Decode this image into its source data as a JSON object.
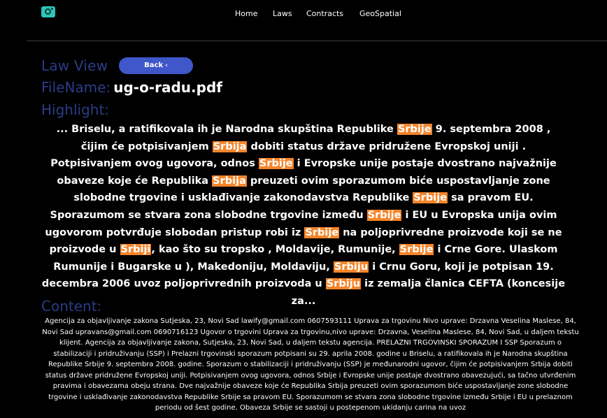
{
  "nav": {
    "logo_icon": "eye-glasses-icon",
    "links": [
      "Home",
      "Laws",
      "Contracts",
      "GeoSpatial"
    ]
  },
  "header": {
    "law_view_label": "Law View",
    "back_label": "Back",
    "back_icon": "chevron-left-icon"
  },
  "file": {
    "label": "FileName:",
    "value": "ug-o-radu.pdf"
  },
  "highlight": {
    "label": "Highlight:",
    "accent_color": "#f5852b",
    "segments": [
      {
        "t": "... Briselu, a ratifikovala ih je Narodna skupština Republike ",
        "h": false
      },
      {
        "t": "Srbije",
        "h": true
      },
      {
        "t": " 9. septembra 2008 , čijim će potpisivanjem ",
        "h": false
      },
      {
        "t": "Srbija",
        "h": true
      },
      {
        "t": " dobiti status države pridružene Evropskoj uniji . Potpisivanjem ovog ugovora, odnos ",
        "h": false
      },
      {
        "t": "Srbije",
        "h": true
      },
      {
        "t": " i Evropske unije postaje dvostrano najvažnije obaveze koje će Republika ",
        "h": false
      },
      {
        "t": "Srbija",
        "h": true
      },
      {
        "t": " preuzeti ovim sporazumom biće uspostavljanje zone slobodne trgovine i usklađivanje zakonodavstva Republike ",
        "h": false
      },
      {
        "t": "Srbije",
        "h": true
      },
      {
        "t": " sa pravom EU. Sporazumom se stvara zona slobodne trgovine između ",
        "h": false
      },
      {
        "t": "Srbije",
        "h": true
      },
      {
        "t": " i EU u Evropska unija ovim ugovorom potvrđuje slobodan pristup robi iz ",
        "h": false
      },
      {
        "t": "Srbije",
        "h": true
      },
      {
        "t": " na poljoprivredne proizvode koji se ne proizvode u ",
        "h": false
      },
      {
        "t": "Srbiji",
        "h": true
      },
      {
        "t": ", kao što su tropsko , Moldavije, Rumunije, ",
        "h": false
      },
      {
        "t": "Srbije",
        "h": true
      },
      {
        "t": " i Crne Gore. Ulaskom Rumunije i Bugarske u ), Makedoniju, Moldaviju, ",
        "h": false
      },
      {
        "t": "Srbiju",
        "h": true
      },
      {
        "t": " i Crnu Goru, koji je potpisan 19. decembra 2006 uvoz poljoprivrednih proizvoda u ",
        "h": false
      },
      {
        "t": "Srbiju",
        "h": true
      },
      {
        "t": " iz zemalja članica CEFTA (koncesije za...",
        "h": false
      }
    ]
  },
  "content": {
    "label": "Content:",
    "text": "Agencija za objavljivanje zakona Sutjeska, 23, Novi Sad lawify@gmail.com 0607593111 Uprava za trgovinu Nivo uprave: Drzavna Veselina Maslese, 84, Novi Sad upravans@gmail.com 0690716123 Ugovor o trgovini Uprava za trgovinu,nivo uprave: Drzavna, Veselina Maslese, 84, Novi Sad, u daljem tekstu klijent. Agencija za objavljivanje zakona, Sutjeska, 23, Novi Sad, u daljem tekstu agencija. PRELAZNI TRGOVINSKI SPORAZUM I SSP Sporazum o stabilizaciji i pridruživanju (SSP) i Prelazni trgovinski sporazum potpisani su 29. aprila 2008. godine u Briselu, a ratifikovala ih je Narodna skupština Republike Srbije 9. septembra 2008. godine. Sporazum o stabilizaciji i pridruživanju (SSP) je međunarodni ugovor, čijim će potpisivanjem Srbija dobiti status države pridružene Evropskoj uniji. Potpisivanjem ovog ugovora, odnos Srbije i Evropske unije postaje dvostrano obavezujući, sa tačno utvrđenim pravima i obavezama obeju strana. Dve najvažnije obaveze koje će Republika Srbija preuzeti ovim sporazumom biće uspostavljanje zone slobodne trgovine i usklađivanje zakonodavstva Republike Srbije sa pravom EU. Sporazumom se stvara zona slobodne trgovine između Srbije i EU u prelaznom periodu od šest godine. Obaveza Srbije se sastoji u postepenom ukidanju carina na uvoz"
  }
}
